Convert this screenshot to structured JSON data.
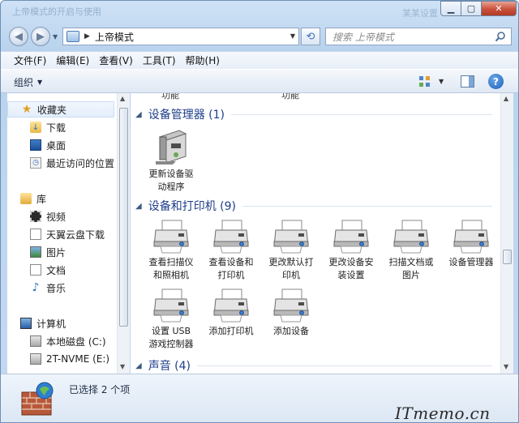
{
  "window": {
    "title": "上帝模式的开启与使用",
    "title_right": "某某设置"
  },
  "nav": {
    "address": "上帝模式",
    "search_placeholder": "搜索 上帝模式"
  },
  "menu": [
    "文件(F)",
    "编辑(E)",
    "查看(V)",
    "工具(T)",
    "帮助(H)"
  ],
  "toolbar": {
    "organize_label": "组织",
    "help_label": "?"
  },
  "sidebar": {
    "favorites": {
      "label": "收藏夹",
      "items": [
        "下载",
        "桌面",
        "最近访问的位置"
      ]
    },
    "libraries": {
      "label": "库",
      "items": [
        "视频",
        "天翼云盘下载",
        "图片",
        "文档",
        "音乐"
      ]
    },
    "computer": {
      "label": "计算机",
      "items": [
        "本地磁盘 (C:)",
        "2T-NVME (E:)"
      ]
    }
  },
  "main": {
    "cut_labels": [
      "功能",
      "功能"
    ],
    "sections": [
      {
        "title": "设备管理器 (1)",
        "tasks": [
          {
            "line1": "更新设备驱",
            "line2": "动程序",
            "icon": "device-manager-icon"
          }
        ]
      },
      {
        "title": "设备和打印机 (9)",
        "tasks": [
          {
            "line1": "查看扫描仪",
            "line2": "和照相机",
            "icon": "printer-icon"
          },
          {
            "line1": "查看设备和",
            "line2": "打印机",
            "icon": "printer-icon"
          },
          {
            "line1": "更改默认打",
            "line2": "印机",
            "icon": "printer-icon"
          },
          {
            "line1": "更改设备安",
            "line2": "装设置",
            "icon": "printer-icon"
          },
          {
            "line1": "扫描文档或",
            "line2": "图片",
            "icon": "printer-icon"
          },
          {
            "line1": "设备管理器",
            "line2": "",
            "icon": "printer-icon"
          },
          {
            "line1": "设置 USB",
            "line2": "游戏控制器",
            "icon": "printer-icon"
          },
          {
            "line1": "添加打印机",
            "line2": "",
            "icon": "printer-icon"
          },
          {
            "line1": "添加设备",
            "line2": "",
            "icon": "printer-icon"
          }
        ]
      },
      {
        "title": "声音 (4)",
        "tasks": []
      }
    ]
  },
  "status": {
    "text": "已选择 2 个项",
    "watermark": "ITmemo.cn"
  },
  "colors": {
    "section_title": "#1e3f8a",
    "frame": "#b9d3ee",
    "close_button": "#c9503a"
  }
}
